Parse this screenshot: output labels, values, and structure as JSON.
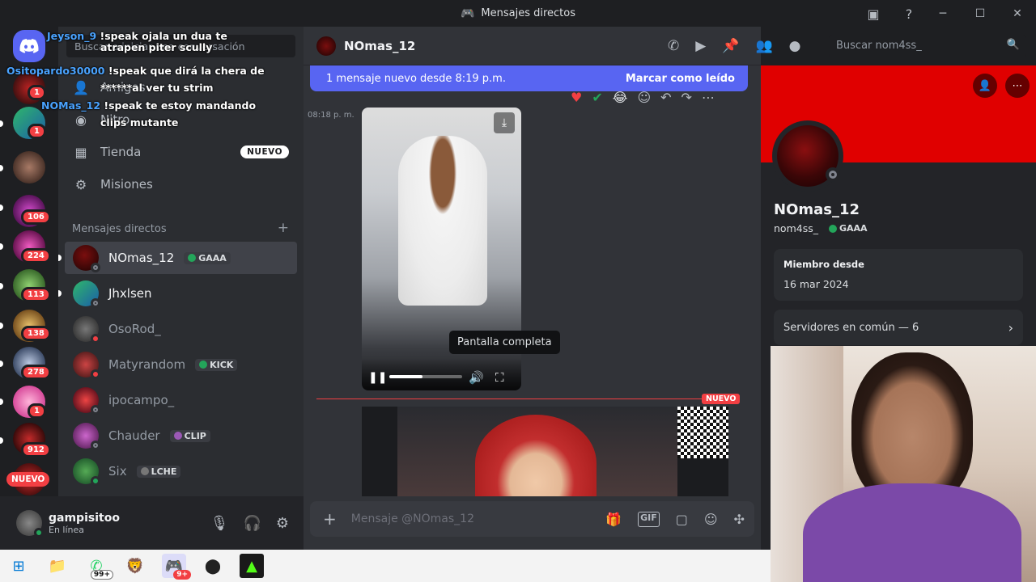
{
  "window": {
    "title": "Mensajes directos"
  },
  "guilds": {
    "badges": [
      "1",
      "1",
      "106",
      "224",
      "113",
      "138",
      "278",
      "1",
      "912"
    ],
    "new_label": "NUEVO"
  },
  "sidebar": {
    "search_placeholder": "Buscar o iniciar una conversación",
    "nav": [
      {
        "label": "Amigos"
      },
      {
        "label": "Nitro"
      },
      {
        "label": "Tienda",
        "badge": "NUEVO"
      },
      {
        "label": "Misiones"
      }
    ],
    "dm_header": "Mensajes directos",
    "dms": [
      {
        "name": "NOmas_12",
        "tag": "GAAA"
      },
      {
        "name": "Jhxlsen",
        "tag": ""
      },
      {
        "name": "OsoRod_",
        "tag": ""
      },
      {
        "name": "Matyrandom",
        "tag": "KICK"
      },
      {
        "name": "ipocampo_",
        "tag": ""
      },
      {
        "name": "Chauder",
        "tag": "CLIP"
      },
      {
        "name": "Six",
        "tag": "LCHE"
      }
    ]
  },
  "user_panel": {
    "name": "gampisitoo",
    "status": "En línea"
  },
  "chat": {
    "channel_name": "NOmas_12",
    "search_placeholder": "Buscar nom4ss_",
    "new_messages": "1 mensaje nuevo desde 8:19 p.m.",
    "mark_read": "Marcar como leído",
    "timestamp": "08:18 p. m.",
    "tooltip": "Pantalla completa",
    "new_divider": "NUEVO",
    "composer_placeholder": "Mensaje @NOmas_12"
  },
  "profile": {
    "display_name": "NOmas_12",
    "username": "nom4ss_",
    "tag": "GAAA",
    "member_since_label": "Miembro desde",
    "member_since": "16 mar 2024",
    "mutual_servers": "Servidores en común — 6"
  },
  "stream_chat": [
    {
      "user": "Jeyson_9",
      "text": "!speak ojala un dua te"
    },
    {
      "user": "",
      "text": "atrapen piter scully"
    },
    {
      "user": "Ositopardo30000",
      "text": "!speak que dirá la chera de"
    },
    {
      "user": "",
      "text": "******al ver tu strim"
    },
    {
      "user": "NOMas_12",
      "text": "!speak te estoy mandando"
    },
    {
      "user": "",
      "text": "clips mutante"
    }
  ],
  "taskbar": {
    "whatsapp_badge": "99+",
    "discord_badge": "9+"
  },
  "colors": {
    "blurple": "#5865f2",
    "red": "#f23f43",
    "green": "#23a55a",
    "banner": "#e00000"
  }
}
